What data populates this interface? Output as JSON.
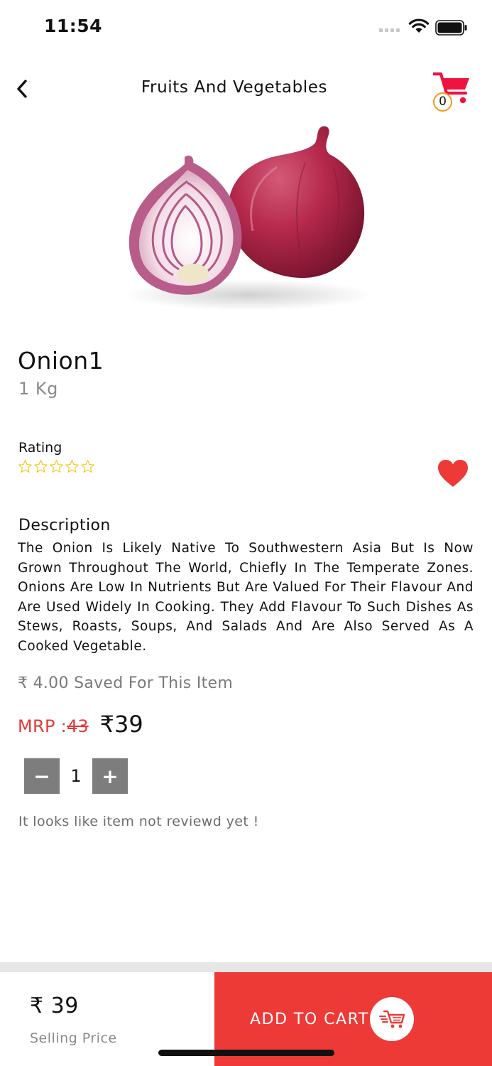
{
  "status": {
    "time": "11:54"
  },
  "header": {
    "title": "Fruits And Vegetables",
    "cart_count": "0"
  },
  "product": {
    "name": "Onion1",
    "quantity": "1 Kg",
    "rating_label": "Rating",
    "rating_value": 0,
    "rating_max": 5,
    "favorite": true,
    "description_label": "Description",
    "description": "The Onion Is Likely Native To Southwestern Asia But Is Now Grown Throughout The World, Chiefly In The Temperate Zones. Onions Are Low In Nutrients But Are Valued For Their Flavour And Are Used Widely In Cooking. They Add Flavour To Such Dishes As Stews, Roasts, Soups, And Salads And Are Also Served As A Cooked Vegetable.",
    "saved_text": "₹ 4.00 Saved For This Item",
    "mrp_label": "MRP :",
    "mrp_old": " 43 ",
    "price_now": "₹39",
    "stepper_value": "1",
    "stepper_minus": "−",
    "stepper_plus": "+",
    "review_note": "It looks like item not reviewd yet !"
  },
  "bottom_bar": {
    "selling_price": "₹ 39",
    "selling_label": "Selling Price",
    "add_to_cart_label": "ADD TO CART"
  },
  "colors": {
    "accent_red": "#ed3a37",
    "cart_icon": "#f0123f",
    "cart_badge_border": "#f29a1d",
    "star_outline": "#f5c518",
    "stepper_gray": "#7d7d7d"
  }
}
